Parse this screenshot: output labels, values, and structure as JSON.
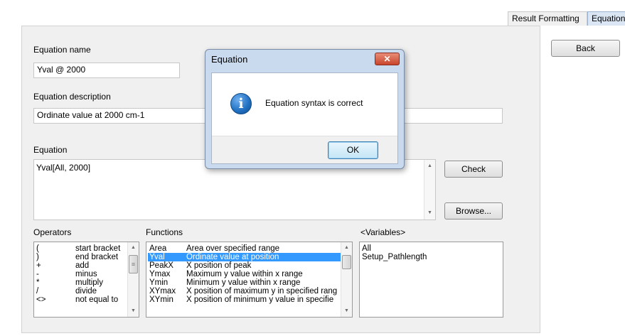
{
  "tabs": [
    "Result Formatting",
    "Equation"
  ],
  "back_label": "Back",
  "equation_name": {
    "label": "Equation name",
    "value": "Yval @ 2000"
  },
  "equation_description": {
    "label": "Equation description",
    "value": "Ordinate value at 2000 cm-1"
  },
  "equation": {
    "label": "Equation",
    "value": "Yval[All, 2000]"
  },
  "check_label": "Check",
  "browse_label": "Browse...",
  "operators": {
    "label": "Operators",
    "items": [
      {
        "symbol": "(",
        "desc": "start bracket"
      },
      {
        "symbol": ")",
        "desc": "end bracket"
      },
      {
        "symbol": "+",
        "desc": "add"
      },
      {
        "symbol": "-",
        "desc": "minus"
      },
      {
        "symbol": "*",
        "desc": "multiply"
      },
      {
        "symbol": "/",
        "desc": "divide"
      },
      {
        "symbol": "<>",
        "desc": "not equal to"
      }
    ]
  },
  "functions": {
    "label": "Functions",
    "items": [
      {
        "name": "Area",
        "desc": "Area over specified range"
      },
      {
        "name": "Yval",
        "desc": "Ordinate value at position"
      },
      {
        "name": "PeakX",
        "desc": "X position of peak"
      },
      {
        "name": "Ymax",
        "desc": "Maximum y value within x range"
      },
      {
        "name": "Ymin",
        "desc": "Minimum y value within x range"
      },
      {
        "name": "XYmax",
        "desc": "X position of maximum y in specified rang"
      },
      {
        "name": "XYmin",
        "desc": "X position of minimum y value in specifie"
      }
    ],
    "selected_index": 1
  },
  "variables": {
    "label": "<Variables>",
    "items": [
      "All",
      "Setup_Pathlength"
    ]
  },
  "dialog": {
    "title": "Equation",
    "message": "Equation syntax is correct",
    "ok_label": "OK",
    "close_glyph": "✕",
    "info_glyph": "i"
  },
  "colors": {
    "selection": "#3399ff",
    "dialog_frame": "#c9d9ee",
    "info_icon": "#1f6fc0"
  },
  "icons": {
    "scroll_up": "▲",
    "scroll_down": "▼",
    "grip": "≡"
  }
}
